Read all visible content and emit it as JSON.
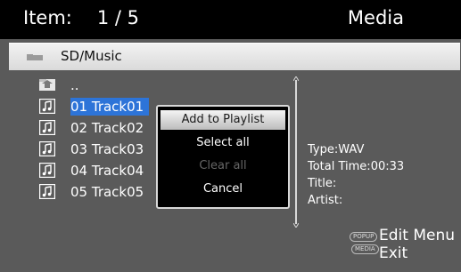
{
  "header": {
    "item_label": "Item:",
    "item_count": "1 / 5",
    "mode": "Media"
  },
  "path": {
    "icon": "folder-icon",
    "text": "SD/Music"
  },
  "file_list": [
    {
      "icon": "parent-folder-icon",
      "label": ".."
    },
    {
      "icon": "music-note-icon",
      "label": "01 Track01"
    },
    {
      "icon": "music-note-icon",
      "label": "02 Track02"
    },
    {
      "icon": "music-note-icon",
      "label": "03 Track03"
    },
    {
      "icon": "music-note-icon",
      "label": "04 Track04"
    },
    {
      "icon": "music-note-icon",
      "label": "05 Track05"
    }
  ],
  "selected_index": 1,
  "popup_menu": {
    "items": [
      {
        "label": "Add to Playlist",
        "state": "focused"
      },
      {
        "label": "Select all",
        "state": "enabled"
      },
      {
        "label": "Clear all",
        "state": "disabled"
      },
      {
        "label": "Cancel",
        "state": "enabled"
      }
    ]
  },
  "info": {
    "type": "Type:WAV",
    "total_time": "Total Time:00:33",
    "title": "Title:",
    "artist": "Artist:"
  },
  "footer": {
    "popup_button": "POPUP",
    "edit_menu": "Edit Menu",
    "media_button": "MEDIA",
    "exit": "Exit"
  },
  "colors": {
    "background": "#5a5a5a",
    "header": "#000000",
    "selection": "#2d74d8",
    "popup_bg": "#000000"
  }
}
